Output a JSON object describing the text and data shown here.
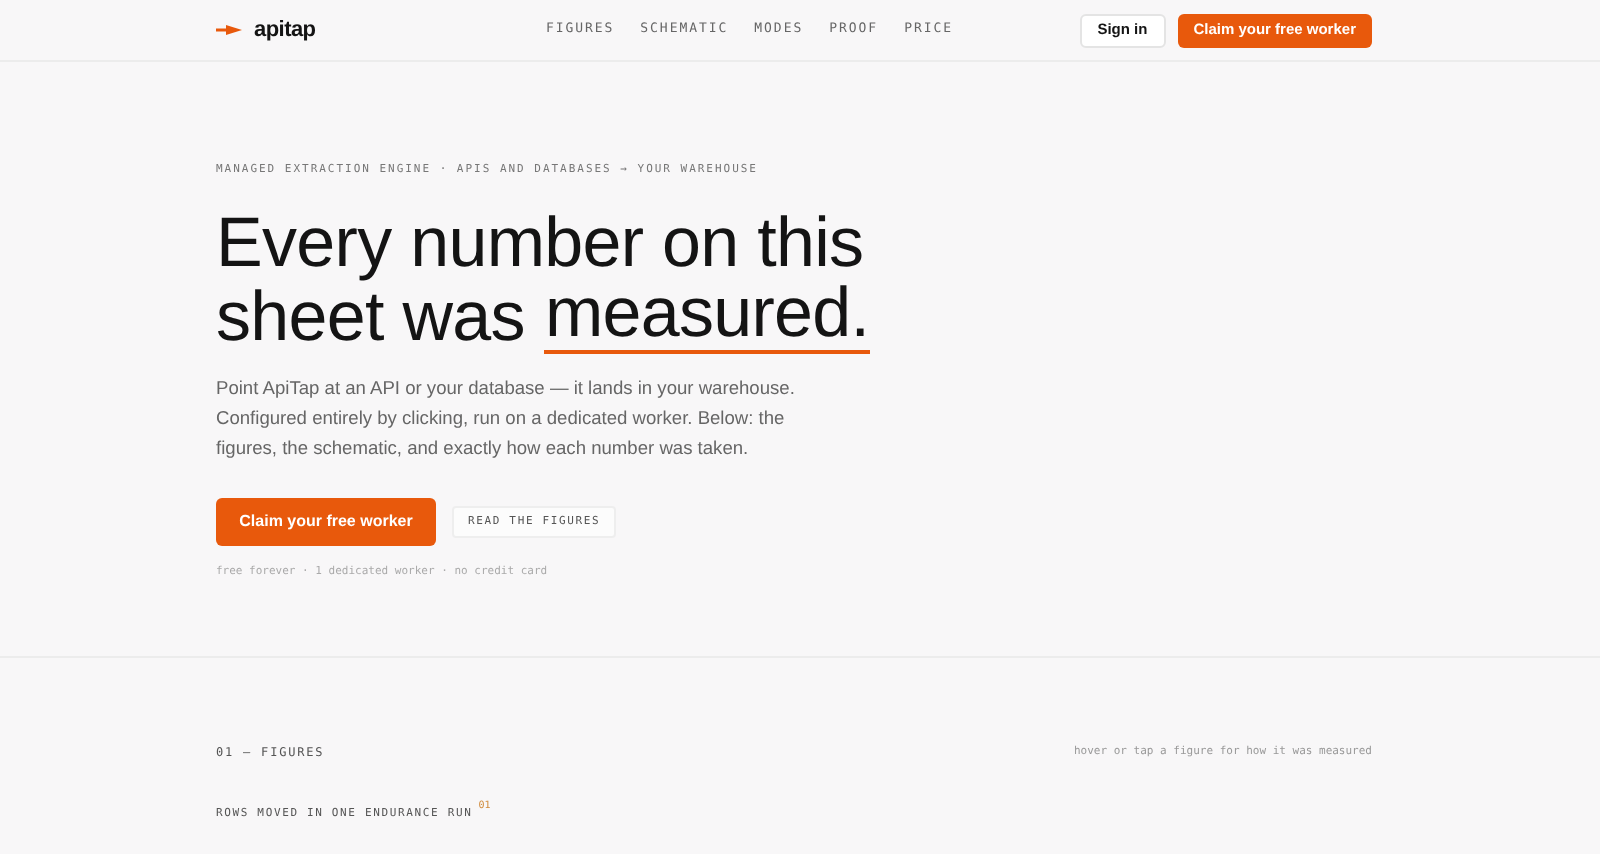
{
  "nav": {
    "brand": "apitap",
    "links": [
      "FIGURES",
      "SCHEMATIC",
      "MODES",
      "PROOF",
      "PRICE"
    ],
    "sign_in": "Sign in",
    "cta": "Claim your free worker"
  },
  "hero": {
    "eyebrow": "MANAGED EXTRACTION ENGINE · APIS AND DATABASES → YOUR WAREHOUSE",
    "headline_line_1": "Every number on this",
    "headline_line_2": "sheet was",
    "headline_underlined": "measured.",
    "body": "Point ApiTap at an API or your database — it lands in your warehouse. Configured entirely by clicking, run on a dedicated worker. Below: the figures, the schematic, and exactly how each number was taken.",
    "primary_button": "Claim your free worker",
    "secondary_button": "READ THE FIGURES",
    "fine_print": "free forever · 1 dedicated worker · no credit card"
  },
  "figures": {
    "section_label": "01 — FIGURES",
    "hint": "hover or tap a figure for how it was measured",
    "figure_label": "ROWS MOVED IN ONE ENDURANCE RUN",
    "footnote": "01"
  }
}
